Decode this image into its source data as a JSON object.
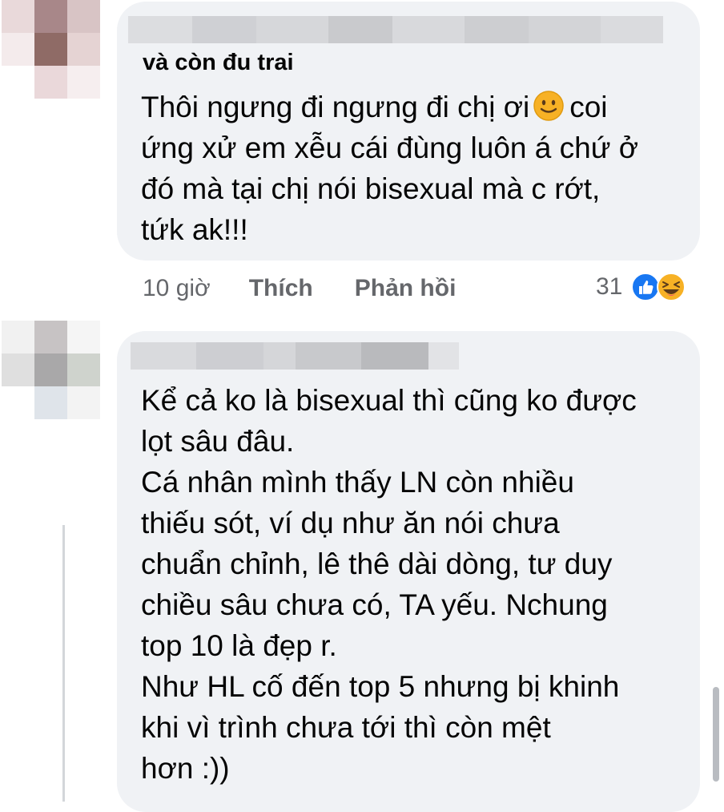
{
  "comments": [
    {
      "author": "và còn đu trai",
      "lines": [
        "Thôi ngưng đi ngưng đi chị ơi",
        "coi",
        "ứng xử em xễu cái đùng luôn á chứ ở",
        "đó mà tại chị nói bisexual mà c rớt,",
        "tứk ak!!!"
      ],
      "time": "10 giờ",
      "like_label": "Thích",
      "reply_label": "Phản hồi",
      "reaction_count": "31",
      "reactions": [
        "like-icon",
        "haha-icon"
      ]
    },
    {
      "lines": [
        "Kể cả ko là bisexual thì cũng ko được",
        "lọt sâu đâu.",
        "Cá nhân mình thấy LN còn nhiều",
        "thiếu sót, ví dụ như ăn nói chưa",
        "chuẩn chỉnh, lê thê dài dòng, tư duy",
        "chiều sâu chưa có, TA yếu. Nchung",
        "top 10 là đẹp r.",
        "Như HL cố đến top 5 nhưng bị khinh",
        "khi vì trình chưa tới thì còn mệt",
        "hơn :))"
      ]
    }
  ],
  "colors": {
    "bubble": "#f0f2f5",
    "meta_text": "#65676b",
    "like_blue": "#1877f2",
    "haha_yellow": "#f7b125"
  }
}
